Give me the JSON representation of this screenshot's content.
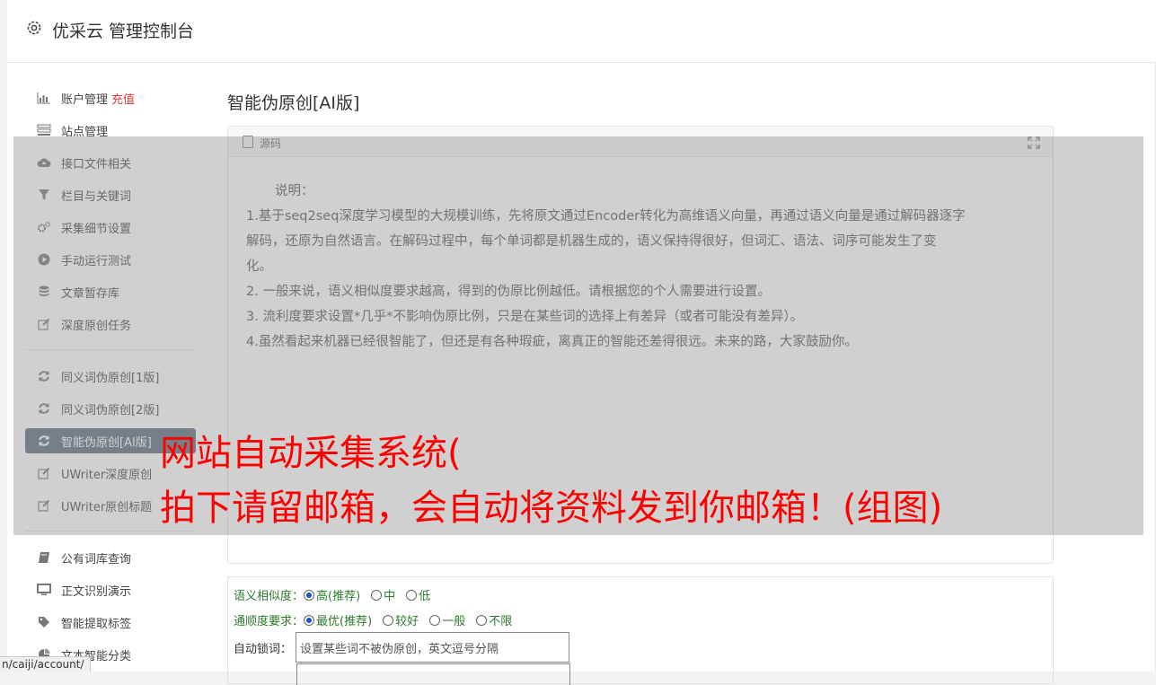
{
  "header": {
    "title": "优采云 管理控制台",
    "icon": "gear-icon"
  },
  "sidebar": {
    "group1": [
      {
        "label": "账户管理",
        "badge": "充值",
        "icon": "bar-chart-icon"
      },
      {
        "label": "站点管理",
        "icon": "list-icon"
      },
      {
        "label": "接口文件相关",
        "icon": "cloud-upload-icon"
      },
      {
        "label": "栏目与关键词",
        "icon": "filter-icon"
      },
      {
        "label": "采集细节设置",
        "icon": "gears-icon"
      },
      {
        "label": "手动运行测试",
        "icon": "play-icon"
      },
      {
        "label": "文章暂存库",
        "icon": "database-icon"
      },
      {
        "label": "深度原创任务",
        "icon": "edit-icon"
      }
    ],
    "group2": [
      {
        "label": "同义词伪原创[1版]",
        "icon": "refresh-icon"
      },
      {
        "label": "同义词伪原创[2版]",
        "icon": "refresh-icon"
      },
      {
        "label": "智能伪原创[AI版]",
        "icon": "refresh-icon",
        "active": true
      },
      {
        "label": "UWriter深度原创",
        "icon": "edit-icon"
      },
      {
        "label": "UWriter原创标题",
        "icon": "edit-icon"
      }
    ],
    "group3": [
      {
        "label": "公有词库查询",
        "icon": "book-icon"
      },
      {
        "label": "正文识别演示",
        "icon": "monitor-icon"
      },
      {
        "label": "智能提取标签",
        "icon": "tag-icon"
      },
      {
        "label": "文本智能分类",
        "icon": "pie-chart-icon"
      }
    ]
  },
  "main": {
    "title": "智能伪原创[AI版]",
    "editor": {
      "source_label": "源码",
      "lines": [
        "说明：",
        "1.基于seq2seq深度学习模型的大规模训练，先将原文通过Encoder转化为高维语义向量，再通过语义向量是通过解码器逐字",
        "解码，还原为自然语言。在解码过程中，每个单词都是机器生成的，语义保持得很好，但词汇、语法、词序可能发生了变",
        "化。",
        "2. 一般来说，语义相似度要求越高，得到的伪原比例越低。请根据您的个人需要进行设置。",
        "3. 流利度要求设置*几乎*不影响伪原比例，只是在某些词的选择上有差异（或者可能没有差异）。",
        "4.虽然看起来机器已经很智能了，但还是有各种瑕疵，离真正的智能还差得很远。未来的路，大家鼓励你。"
      ]
    },
    "settings": {
      "similarity_label": "语义相似度：",
      "similarity_options": [
        "高(推荐)",
        "中",
        "低"
      ],
      "similarity_selected": 0,
      "fluency_label": "通顺度要求：",
      "fluency_options": [
        "最优(推荐)",
        "较好",
        "一般",
        "不限"
      ],
      "fluency_selected": 0,
      "lock_label": "自动锁词：",
      "lock_placeholder": "设置某些词不被伪原创，英文逗号分隔"
    }
  },
  "overlay": {
    "line1": "网站自动采集系统(",
    "line2": "拍下请留邮箱，会自动将资料发到你邮箱！(组图)"
  },
  "statusbar": {
    "url": "n/caiji/account/"
  }
}
